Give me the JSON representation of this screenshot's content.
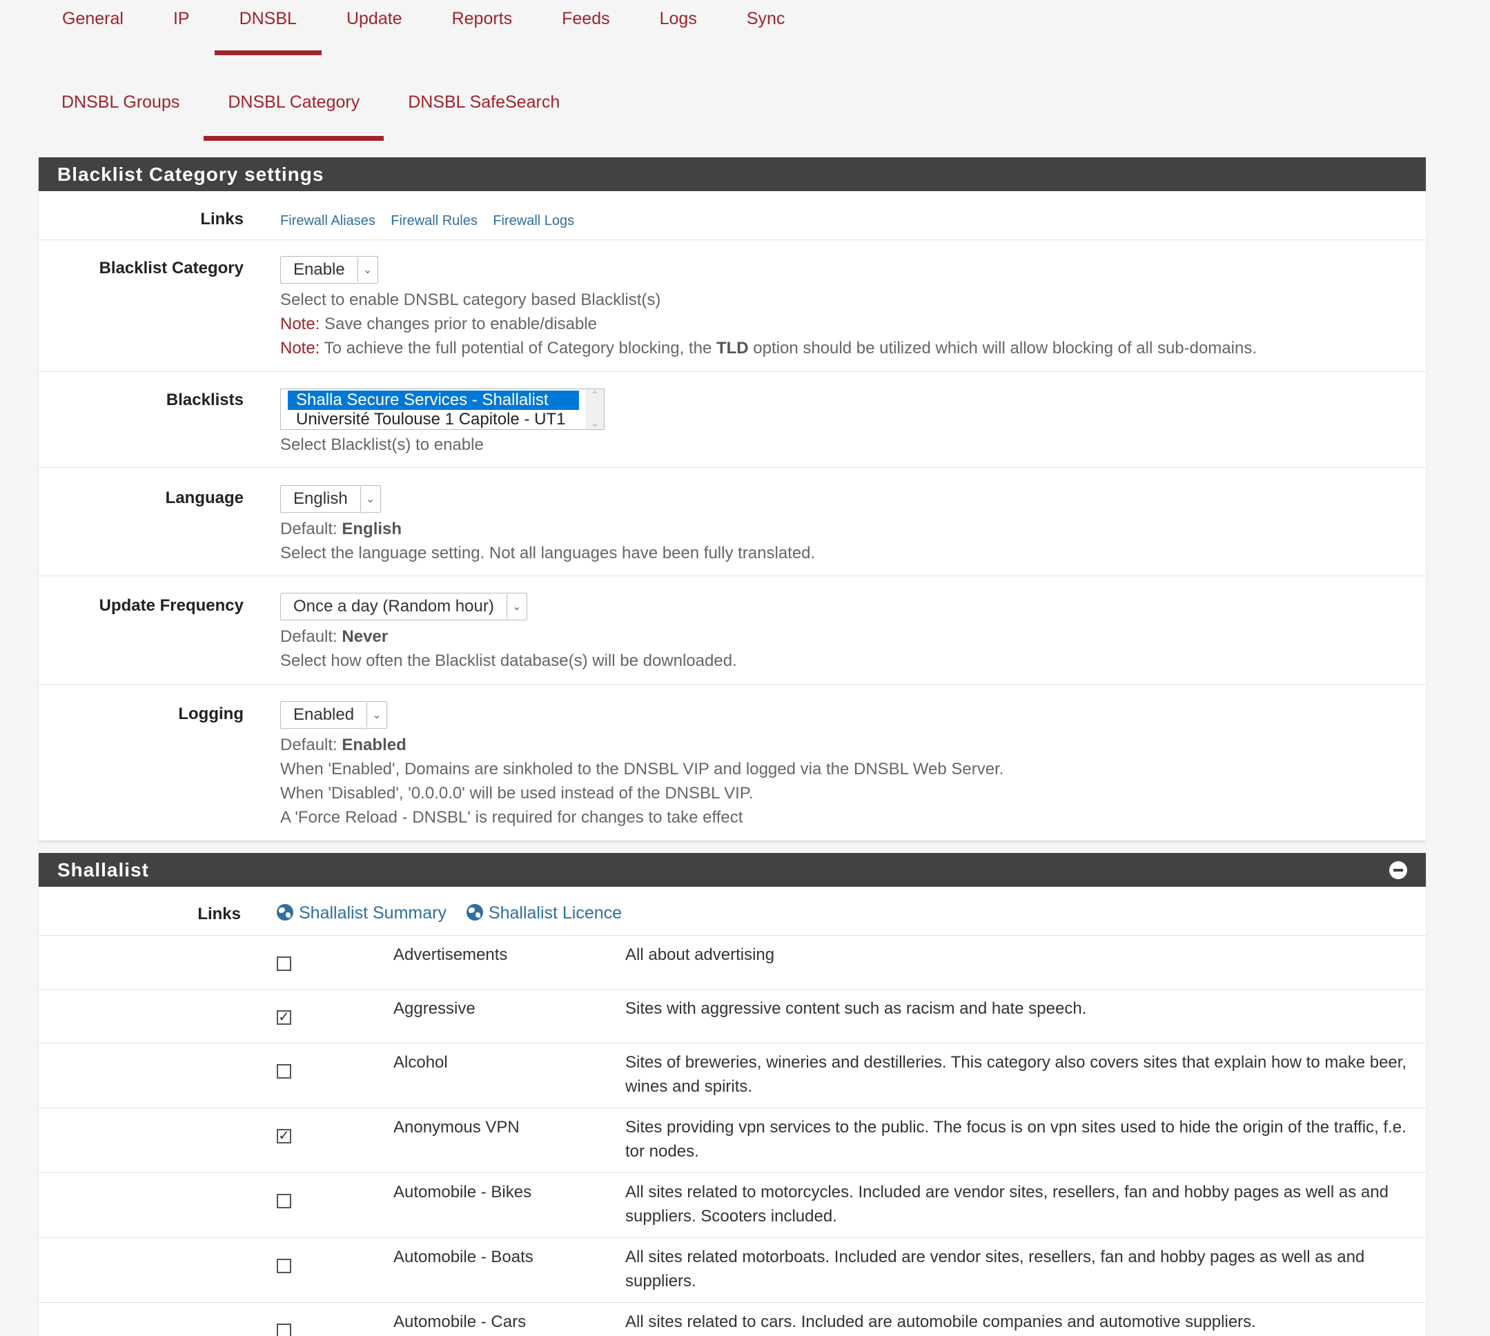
{
  "tabs_primary": [
    {
      "label": "General"
    },
    {
      "label": "IP"
    },
    {
      "label": "DNSBL"
    },
    {
      "label": "Update"
    },
    {
      "label": "Reports"
    },
    {
      "label": "Feeds"
    },
    {
      "label": "Logs"
    },
    {
      "label": "Sync"
    }
  ],
  "tabs_primary_active": "DNSBL",
  "tabs_secondary": [
    {
      "label": "DNSBL Groups"
    },
    {
      "label": "DNSBL Category"
    },
    {
      "label": "DNSBL SafeSearch"
    }
  ],
  "tabs_secondary_active": "DNSBL Category",
  "settings": {
    "title": "Blacklist Category settings",
    "links_label": "Links",
    "links": [
      "Firewall Aliases",
      "Firewall Rules",
      "Firewall Logs"
    ],
    "blacklist_category": {
      "label": "Blacklist Category",
      "value": "Enable",
      "help1": "Select to enable DNSBL category based Blacklist(s)",
      "note_label": "Note:",
      "note1": "Save changes prior to enable/disable",
      "note2_a": "To achieve the full potential of Category blocking, the",
      "note2_bold": "TLD",
      "note2_b": "option should be utilized which will allow blocking of all sub-domains."
    },
    "blacklists": {
      "label": "Blacklists",
      "options": [
        "Shalla Secure Services - Shallalist",
        "Université Toulouse 1 Capitole - UT1"
      ],
      "selected": "Shalla Secure Services - Shallalist",
      "help": "Select Blacklist(s) to enable"
    },
    "language": {
      "label": "Language",
      "value": "English",
      "default_label": "Default:",
      "default_value": "English",
      "help": "Select the language setting. Not all languages have been fully translated."
    },
    "update_frequency": {
      "label": "Update Frequency",
      "value": "Once a day (Random hour)",
      "default_label": "Default:",
      "default_value": "Never",
      "help": "Select how often the Blacklist database(s) will be downloaded."
    },
    "logging": {
      "label": "Logging",
      "value": "Enabled",
      "default_label": "Default:",
      "default_value": "Enabled",
      "help1": "When 'Enabled', Domains are sinkholed to the DNSBL VIP and logged via the DNSBL Web Server.",
      "help2": "When 'Disabled', '0.0.0.0' will be used instead of the DNSBL VIP.",
      "help3": "A 'Force Reload - DNSBL' is required for changes to take effect"
    }
  },
  "shallalist": {
    "title": "Shallalist",
    "links_label": "Links",
    "links": [
      "Shallalist Summary",
      "Shallalist Licence"
    ],
    "categories": [
      {
        "name": "Advertisements",
        "desc": "All about advertising",
        "checked": false
      },
      {
        "name": "Aggressive",
        "desc": "Sites with aggressive content such as racism and hate speech.",
        "checked": true
      },
      {
        "name": "Alcohol",
        "desc": "Sites of breweries, wineries and destilleries. This category also covers sites that explain how to make beer, wines and spirits.",
        "checked": false
      },
      {
        "name": "Anonymous VPN",
        "desc": "Sites providing vpn services to the public. The focus is on vpn sites used to hide the origin of the traffic, f.e. tor nodes.",
        "checked": true
      },
      {
        "name": "Automobile - Bikes",
        "desc": "All sites related to motorcycles. Included are vendor sites, resellers, fan and hobby pages as well as and suppliers. Scooters included.",
        "checked": false
      },
      {
        "name": "Automobile - Boats",
        "desc": "All sites related motorboats. Included are vendor sites, resellers, fan and hobby pages as well as and suppliers.",
        "checked": false
      },
      {
        "name": "Automobile - Cars",
        "desc": "All sites related to cars. Included are automobile companies and automotive suppliers.",
        "checked": false
      }
    ]
  }
}
